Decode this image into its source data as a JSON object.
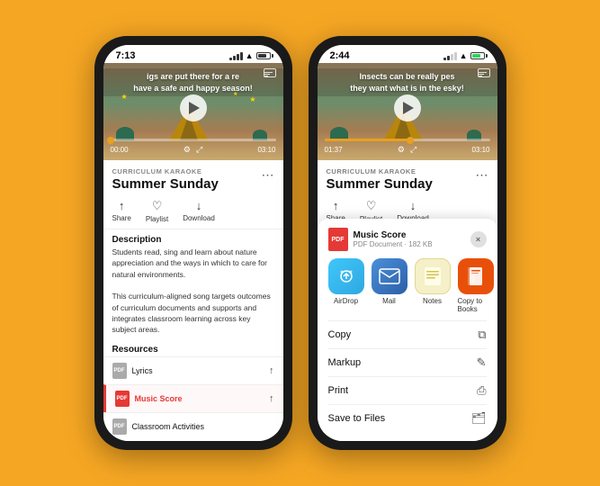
{
  "phone_left": {
    "status": {
      "time": "7:13",
      "signal": "90%",
      "battery": "full"
    },
    "video": {
      "text_line1": "igs are put there for a re",
      "text_line2": "have a safe and happy season!",
      "time_current": "00:00",
      "time_total": "03:10",
      "progress_percent": 0
    },
    "content": {
      "label": "CURRICULUM KARAOKE",
      "title": "Summer Sunday",
      "actions": {
        "share": "Share",
        "playlist": "Playlist",
        "download": "Download"
      },
      "description_title": "Description",
      "description": "Students read, sing and learn about nature appreciation and the ways in which to care for natural environments.\n\nThis curriculum-aligned song targets outcomes of curriculum documents and supports and integrates classroom learning across key subject areas.",
      "resources_title": "Resources",
      "resources": [
        {
          "name": "Lyrics",
          "type": "pdf",
          "highlighted": false
        },
        {
          "name": "Music Score",
          "type": "pdf",
          "highlighted": true
        },
        {
          "name": "Classroom Activities",
          "type": "pdf",
          "highlighted": false
        }
      ]
    }
  },
  "phone_right": {
    "status": {
      "time": "2:44",
      "signal": "50%",
      "battery": "full"
    },
    "video": {
      "text_line1": "Insects can be really pes",
      "text_line2": "they want what is in the esky!",
      "time_current": "01:37",
      "time_total": "03:10",
      "progress_percent": 52
    },
    "content": {
      "label": "CURRICULUM KARAOKE",
      "title": "Summer Sunday",
      "actions": {
        "share": "Share",
        "playlist": "Playlist",
        "download": "Download"
      }
    },
    "share_sheet": {
      "file_name": "Music Score",
      "file_type": "PDF Document",
      "file_size": "182 KB",
      "close_label": "×",
      "apps": [
        {
          "name": "AirDrop",
          "type": "airdrop"
        },
        {
          "name": "Mail",
          "type": "mail"
        },
        {
          "name": "Notes",
          "type": "notes"
        },
        {
          "name": "Copy to Books",
          "type": "books"
        }
      ],
      "actions": [
        {
          "name": "Copy",
          "icon": "copy"
        },
        {
          "name": "Markup",
          "icon": "markup"
        },
        {
          "name": "Print",
          "icon": "print"
        },
        {
          "name": "Save to Files",
          "icon": "files"
        }
      ]
    }
  },
  "icons": {
    "share": "↑",
    "playlist": "♡",
    "download": "↓",
    "more": "•••",
    "close": "×",
    "copy_icon": "⧉",
    "markup_icon": "✎",
    "print_icon": "⎙",
    "files_icon": "🗂"
  }
}
